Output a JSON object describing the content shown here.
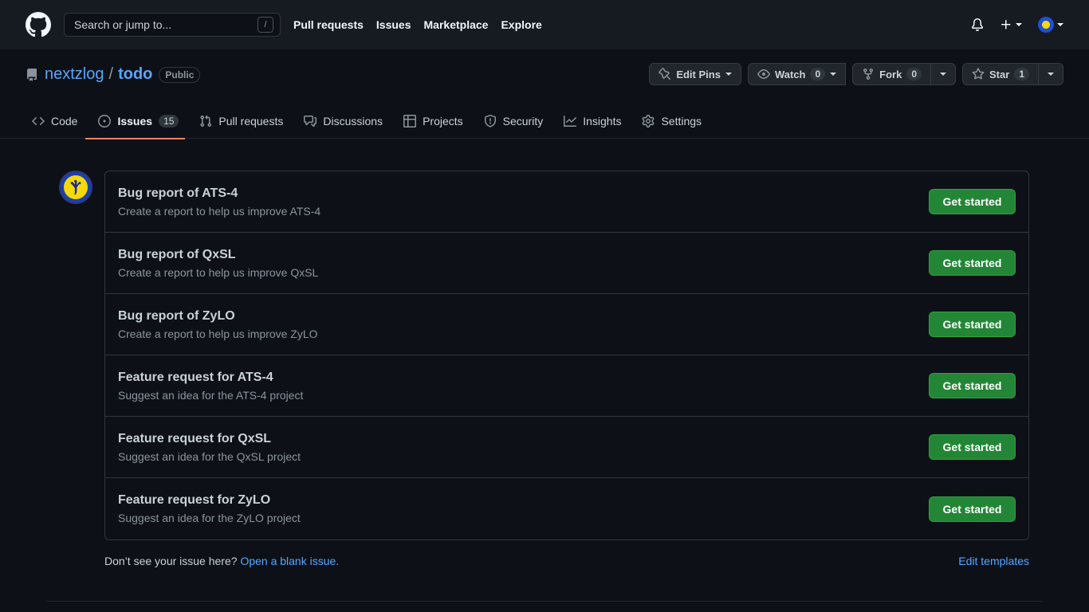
{
  "header": {
    "search_placeholder": "Search or jump to...",
    "search_shortcut": "/",
    "nav": [
      "Pull requests",
      "Issues",
      "Marketplace",
      "Explore"
    ],
    "plus_label": "+"
  },
  "repo": {
    "owner": "nextzlog",
    "separator": "/",
    "name": "todo",
    "visibility": "Public",
    "actions": {
      "edit_pins": "Edit Pins",
      "watch": "Watch",
      "watch_count": "0",
      "fork": "Fork",
      "fork_count": "0",
      "star": "Star",
      "star_count": "1"
    },
    "tabs": [
      {
        "label": "Code"
      },
      {
        "label": "Issues",
        "count": "15"
      },
      {
        "label": "Pull requests"
      },
      {
        "label": "Discussions"
      },
      {
        "label": "Projects"
      },
      {
        "label": "Security"
      },
      {
        "label": "Insights"
      },
      {
        "label": "Settings"
      }
    ]
  },
  "templates": [
    {
      "title": "Bug report of ATS-4",
      "description": "Create a report to help us improve ATS-4",
      "button": "Get started"
    },
    {
      "title": "Bug report of QxSL",
      "description": "Create a report to help us improve QxSL",
      "button": "Get started"
    },
    {
      "title": "Bug report of ZyLO",
      "description": "Create a report to help us improve ZyLO",
      "button": "Get started"
    },
    {
      "title": "Feature request for ATS-4",
      "description": "Suggest an idea for the ATS-4 project",
      "button": "Get started"
    },
    {
      "title": "Feature request for QxSL",
      "description": "Suggest an idea for the QxSL project",
      "button": "Get started"
    },
    {
      "title": "Feature request for ZyLO",
      "description": "Suggest an idea for the ZyLO project",
      "button": "Get started"
    }
  ],
  "footer": {
    "prompt": "Don’t see your issue here?",
    "blank_link": "Open a blank issue.",
    "edit_templates": "Edit templates"
  },
  "colors": {
    "background": "#0d1117",
    "header": "#161b22",
    "link": "#58a6ff",
    "primary_button": "#238636",
    "selected_tab_underline": "#f78166"
  },
  "icons": [
    "github-logo-icon",
    "bell-icon",
    "plus-icon",
    "repo-icon",
    "pin-icon",
    "eye-icon",
    "fork-icon",
    "star-icon",
    "code-icon",
    "issue-icon",
    "pull-request-icon",
    "discussion-icon",
    "project-icon",
    "shield-icon",
    "graph-icon",
    "gear-icon"
  ]
}
